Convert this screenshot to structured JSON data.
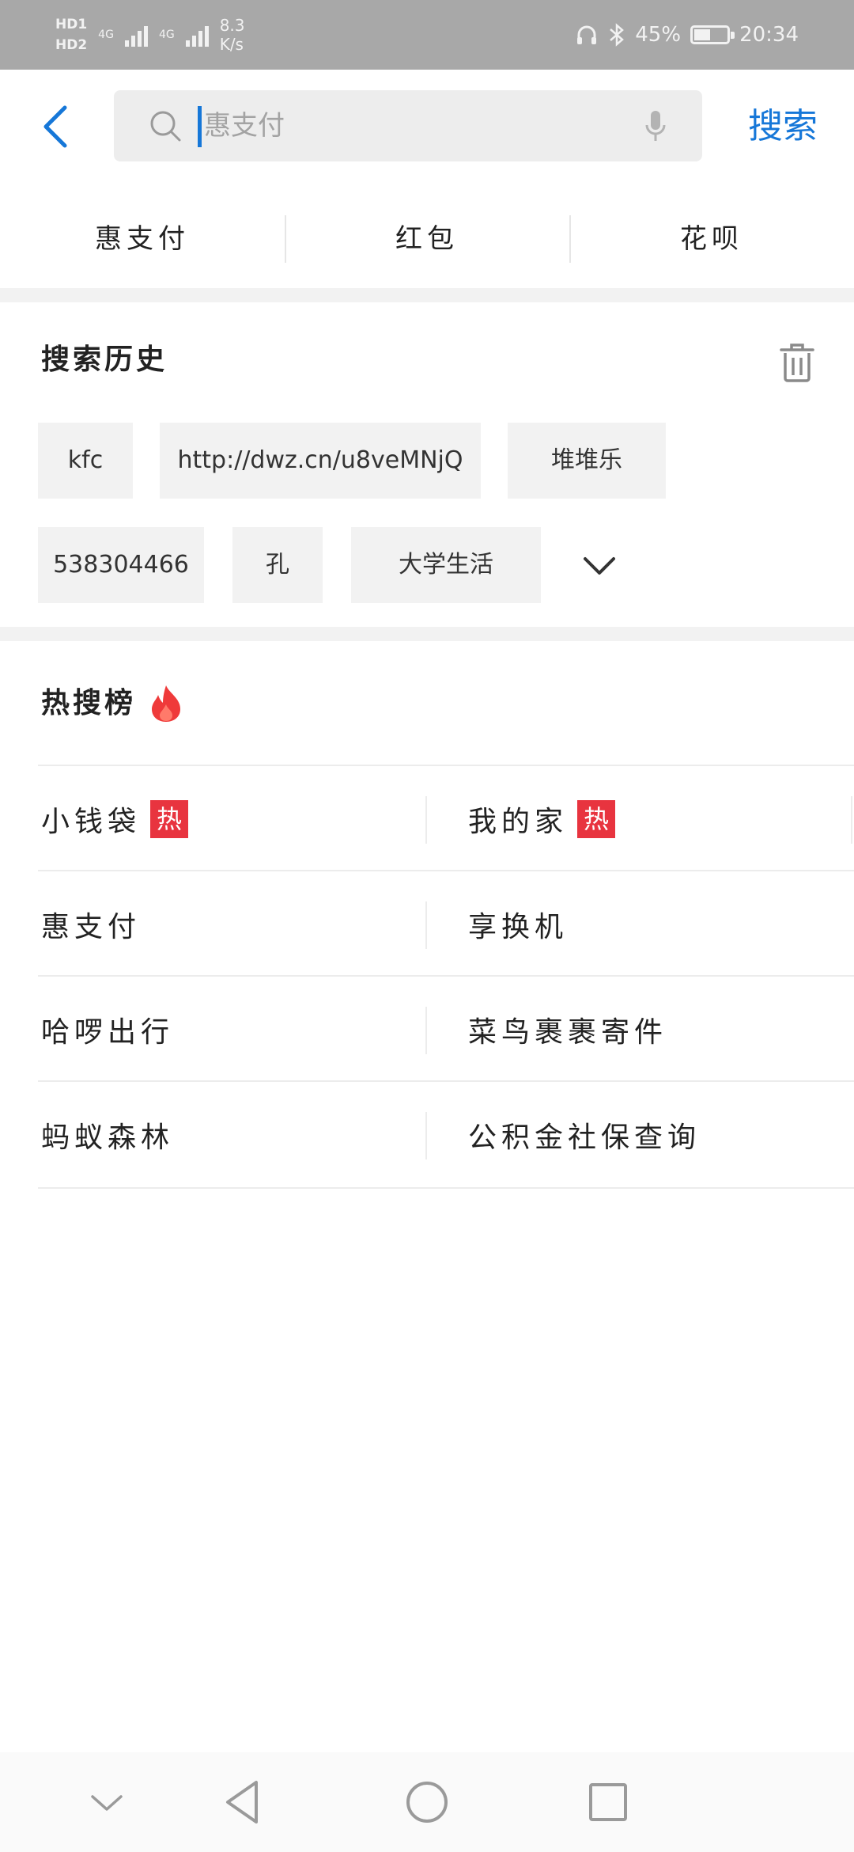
{
  "status_bar": {
    "hd1": "HD1",
    "hd2": "HD2",
    "net1": "4G",
    "net2": "4G",
    "speed_value": "8.3",
    "speed_unit": "K/s",
    "battery": "45%",
    "battery_level": 0.45,
    "time": "20:34"
  },
  "search": {
    "placeholder": "惠支付",
    "button_label": "搜索"
  },
  "quick_tabs": [
    "惠支付",
    "红包",
    "花呗"
  ],
  "history": {
    "title": "搜索历史",
    "chips": [
      "kfc",
      "http://dwz.cn/u8veMNjQ",
      "堆堆乐",
      "538304466",
      "孔",
      "大学生活"
    ]
  },
  "hot": {
    "title": "热搜榜",
    "badge": "热",
    "rows": [
      {
        "left": "小钱袋",
        "left_hot": true,
        "right": "我的家",
        "right_hot": true
      },
      {
        "left": "惠支付",
        "left_hot": false,
        "right": "享换机",
        "right_hot": false
      },
      {
        "left": "哈啰出行",
        "left_hot": false,
        "right": "菜鸟裹裹寄件",
        "right_hot": false
      },
      {
        "left": "蚂蚁森林",
        "left_hot": false,
        "right": "公积金社保查询",
        "right_hot": false
      }
    ]
  },
  "colors": {
    "accent": "#1677d8",
    "hot_badge": "#e8343f",
    "status_bar": "#a8a8a8"
  },
  "icons": {
    "back": "back-arrow-icon",
    "search": "search-icon",
    "mic": "microphone-icon",
    "trash": "trash-icon",
    "expand": "chevron-down-icon",
    "fire": "fire-icon",
    "nav_collapse": "chevron-down-icon",
    "nav_back": "triangle-back-icon",
    "nav_home": "circle-home-icon",
    "nav_recents": "square-recents-icon"
  }
}
